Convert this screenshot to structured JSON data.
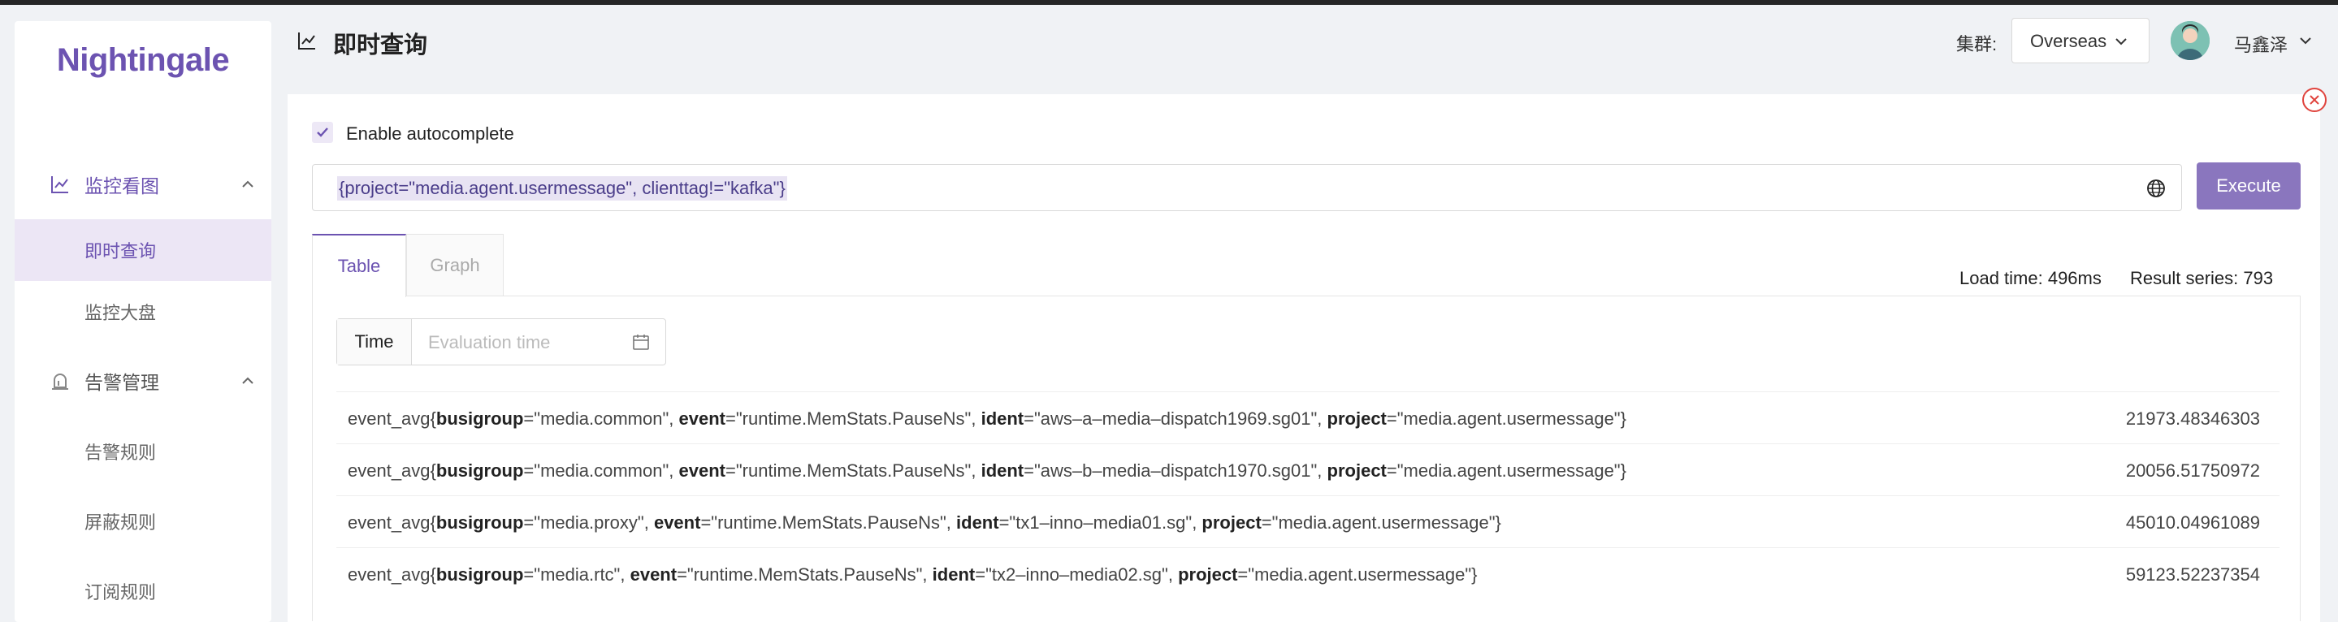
{
  "brand": "Nightingale",
  "sidebar": {
    "groups": [
      {
        "label": "监控看图",
        "items": [
          "即时查询",
          "监控大盘"
        ]
      },
      {
        "label": "告警管理",
        "items": [
          "告警规则",
          "屏蔽规则",
          "订阅规则"
        ]
      }
    ]
  },
  "header": {
    "title": "即时查询",
    "cluster_label": "集群:",
    "cluster_value": "Overseas",
    "username": "马鑫泽"
  },
  "query": {
    "autocomplete_label": "Enable autocomplete",
    "autocomplete_checked": true,
    "expression": "{project=\"media.agent.usermessage\", clienttag!=\"kafka\"}",
    "execute_label": "Execute"
  },
  "tabs": [
    {
      "label": "Table",
      "active": true
    },
    {
      "label": "Graph",
      "active": false
    }
  ],
  "stats": {
    "load_time": "Load time: 496ms",
    "result_series": "Result series: 793"
  },
  "time": {
    "label": "Time",
    "placeholder": "Evaluation time"
  },
  "results": [
    {
      "name": "event_avg",
      "labels": [
        {
          "k": "busigroup",
          "v": "media.common"
        },
        {
          "k": "event",
          "v": "runtime.MemStats.PauseNs"
        },
        {
          "k": "ident",
          "v": "aws–a–media–dispatch1969.sg01"
        },
        {
          "k": "project",
          "v": "media.agent.usermessage"
        }
      ],
      "value": "21973.48346303"
    },
    {
      "name": "event_avg",
      "labels": [
        {
          "k": "busigroup",
          "v": "media.common"
        },
        {
          "k": "event",
          "v": "runtime.MemStats.PauseNs"
        },
        {
          "k": "ident",
          "v": "aws–b–media–dispatch1970.sg01"
        },
        {
          "k": "project",
          "v": "media.agent.usermessage"
        }
      ],
      "value": "20056.51750972"
    },
    {
      "name": "event_avg",
      "labels": [
        {
          "k": "busigroup",
          "v": "media.proxy"
        },
        {
          "k": "event",
          "v": "runtime.MemStats.PauseNs"
        },
        {
          "k": "ident",
          "v": "tx1–inno–media01.sg"
        },
        {
          "k": "project",
          "v": "media.agent.usermessage"
        }
      ],
      "value": "45010.04961089"
    },
    {
      "name": "event_avg",
      "labels": [
        {
          "k": "busigroup",
          "v": "media.rtc"
        },
        {
          "k": "event",
          "v": "runtime.MemStats.PauseNs"
        },
        {
          "k": "ident",
          "v": "tx2–inno–media02.sg"
        },
        {
          "k": "project",
          "v": "media.agent.usermessage"
        }
      ],
      "value": "59123.52237354"
    }
  ]
}
